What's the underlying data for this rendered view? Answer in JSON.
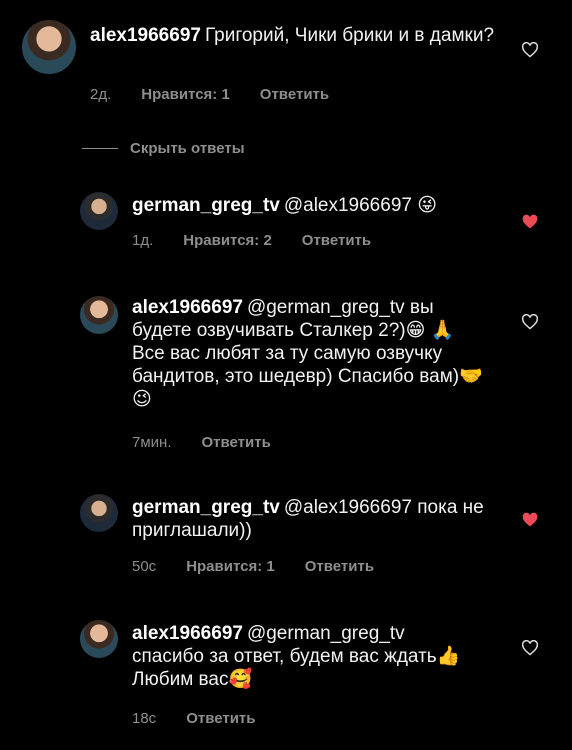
{
  "comments": [
    {
      "user": "alex1966697",
      "text": "Григорий, Чики брики и в дамки?",
      "time": "2д.",
      "likes": "Нравится: 1",
      "reply": "Ответить",
      "liked": false
    },
    {
      "user": "german_greg_tv",
      "mention": "@alex1966697",
      "text": "😜",
      "time": "1д.",
      "likes": "Нравится: 2",
      "reply": "Ответить",
      "liked": true
    },
    {
      "user": "alex1966697",
      "mention": "@german_greg_tv",
      "text": "вы будете озвучивать Сталкер 2?)😁 🙏 Все вас любят за ту самую озвучку бандитов, это шедевр) Спасибо вам)🤝 😉",
      "time": "7мин.",
      "reply": "Ответить",
      "liked": false
    },
    {
      "user": "german_greg_tv",
      "mention": "@alex1966697",
      "text": "пока не приглашали))",
      "time": "50с",
      "likes": "Нравится: 1",
      "reply": "Ответить",
      "liked": true
    },
    {
      "user": "alex1966697",
      "mention": "@german_greg_tv",
      "text": "спасибо за ответ, будем вас ждать👍 Любим вас🥰",
      "time": "18с",
      "reply": "Ответить",
      "liked": false
    }
  ],
  "hide_replies": "Скрыть ответы",
  "colors": {
    "liked": "#ed4956",
    "muted": "#8e8e8e"
  }
}
